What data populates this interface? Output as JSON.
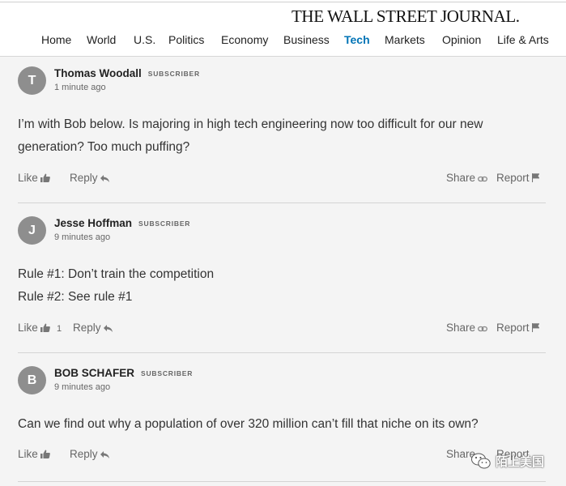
{
  "site": {
    "masthead": "THE WALL STREET JOURNAL."
  },
  "nav": {
    "items": [
      "Home",
      "World",
      "U.S.",
      "Politics",
      "Economy",
      "Business",
      "Tech",
      "Markets",
      "Opinion",
      "Life & Arts"
    ],
    "active": "Tech",
    "active_color": "#0274b6"
  },
  "comments": [
    {
      "avatar_initial": "T",
      "author": "Thomas Woodall",
      "badge": "SUBSCRIBER",
      "time": "1 minute ago",
      "body": [
        "I’m with Bob below.  Is majoring in high tech engineering now too difficult for our new",
        "generation?  Too much puffing?"
      ],
      "like_label": "Like",
      "like_count": "",
      "reply_label": "Reply",
      "share_label": "Share",
      "report_label": "Report"
    },
    {
      "avatar_initial": "J",
      "author": "Jesse Hoffman",
      "badge": "SUBSCRIBER",
      "time": "9 minutes ago",
      "body": [
        "Rule #1: Don’t train the competition",
        "Rule #2: See rule #1"
      ],
      "like_label": "Like",
      "like_count": "1",
      "reply_label": "Reply",
      "share_label": "Share",
      "report_label": "Report"
    },
    {
      "avatar_initial": "B",
      "author": "BOB SCHAFER",
      "badge": "SUBSCRIBER",
      "time": "9 minutes ago",
      "body": [
        "Can we find out why a population of over 320 million can’t fill that niche on its own?"
      ],
      "like_label": "Like",
      "like_count": "",
      "reply_label": "Reply",
      "share_label": "Share",
      "report_label": "Report"
    }
  ],
  "watermark": {
    "text": "陌上美国",
    "icon": "wechat-logo-icon"
  },
  "icons": {
    "like": "thumbs-up-icon",
    "reply": "reply-arrow-icon",
    "share": "link-icon",
    "report": "flag-icon"
  }
}
